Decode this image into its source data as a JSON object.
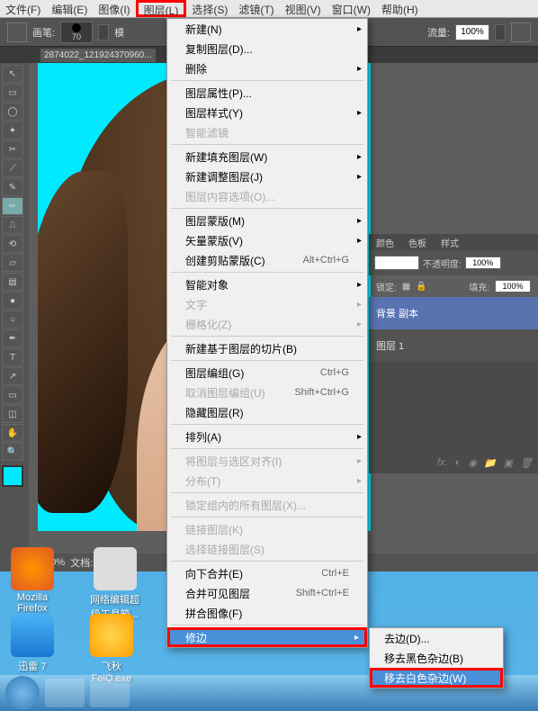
{
  "menu_bar": {
    "file": "文件(F)",
    "edit": "编辑(E)",
    "image": "图像(I)",
    "layer": "图层(L)",
    "select": "选择(S)",
    "filter": "滤镜(T)",
    "view": "视图(V)",
    "window": "窗口(W)",
    "help": "帮助(H)"
  },
  "options_bar": {
    "brush_label": "画笔:",
    "brush_size": "70",
    "mode_label": "模",
    "flow_label": "流量:",
    "flow_value": "100%"
  },
  "document_tab": "2874022_121924370960...",
  "status_bar": {
    "zoom": "100%",
    "doc_label": "文档:"
  },
  "layer_menu": {
    "new": "新建(N)",
    "duplicate": "复制图层(D)...",
    "delete": "删除",
    "properties": "图层属性(P)...",
    "layer_style": "图层样式(Y)",
    "smart_filter": "智能滤镜",
    "new_fill": "新建填充图层(W)",
    "new_adjust": "新建调整图层(J)",
    "layer_content": "图层内容选项(O)...",
    "layer_mask": "图层蒙版(M)",
    "vector_mask": "矢量蒙版(V)",
    "create_clip": "创建剪贴蒙版(C)",
    "create_clip_key": "Alt+Ctrl+G",
    "smart_object": "智能对象",
    "type": "文字",
    "rasterize": "栅格化(Z)",
    "new_slice": "新建基于图层的切片(B)",
    "group": "图层编组(G)",
    "group_key": "Ctrl+G",
    "ungroup": "取消图层编组(U)",
    "ungroup_key": "Shift+Ctrl+G",
    "hide": "隐藏图层(R)",
    "arrange": "排列(A)",
    "align": "将图层与选区对齐(I)",
    "distribute": "分布(T)",
    "lock_all": "锁定组内的所有图层(X)...",
    "link": "链接图层(K)",
    "select_link": "选择链接图层(S)",
    "merge_down": "向下合并(E)",
    "merge_down_key": "Ctrl+E",
    "merge_visible": "合并可见图层",
    "merge_visible_key": "Shift+Ctrl+E",
    "flatten": "拼合图像(F)",
    "matting": "修边"
  },
  "matting_submenu": {
    "defringe": "去边(D)...",
    "remove_black": "移去黑色杂边(B)",
    "remove_white": "移去白色杂边(W)"
  },
  "right_panel": {
    "tab_color": "颜色",
    "tab_swatch": "色板",
    "tab_style": "样式",
    "opacity_label": "不透明度:",
    "opacity_value": "100%",
    "fill_label": "填充:",
    "fill_value": "100%",
    "lock_label": "锁定:",
    "layer1": "背景 副本",
    "layer2": "图层 1",
    "layer_footer": "fx."
  },
  "desktop": {
    "firefox": "Mozilla",
    "firefox2": "Firefox",
    "netedit1": "网络编辑超",
    "netedit2": "级工具箱...",
    "xunlei": "迅雷 7",
    "feiq": "飞秋",
    "feiq2": "FeiQ.exe"
  }
}
